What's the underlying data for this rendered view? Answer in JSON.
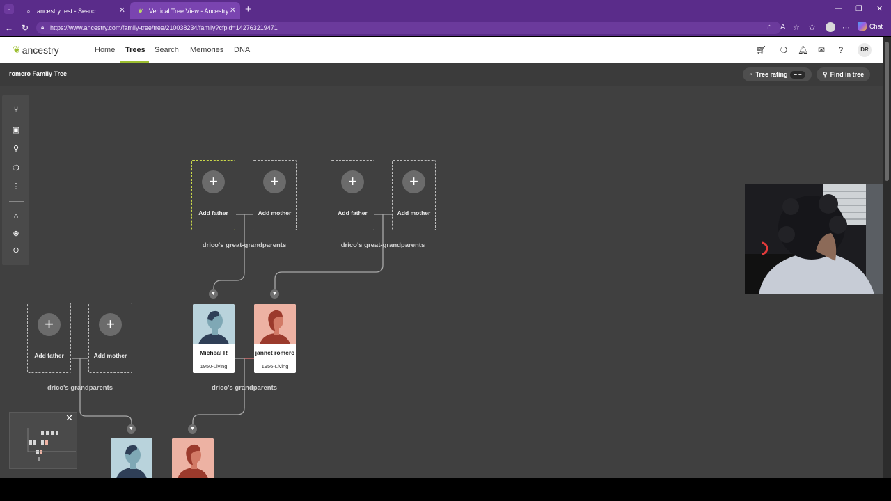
{
  "browser": {
    "tabs": [
      {
        "title": "ancestry test - Search",
        "active": false
      },
      {
        "title": "Vertical Tree View - Ancestry",
        "active": true
      }
    ],
    "url": "https://www.ancestry.com/family-tree/tree/210038234/family?cfpid=142763219471",
    "chat_label": "Chat"
  },
  "site": {
    "logo_text": "ancestry",
    "nav": [
      "Home",
      "Trees",
      "Search",
      "Memories",
      "DNA"
    ],
    "active_nav": "Trees",
    "user_initials": "DR"
  },
  "tree": {
    "title": "romero Family Tree",
    "tree_rating_label": "Tree rating",
    "tree_rating_value": "– –",
    "find_label": "Find in tree"
  },
  "labels": {
    "add_father": "Add father",
    "add_mother": "Add mother",
    "great_grandparents": "drico's great-grandparents",
    "grandparents": "drico's grandparents"
  },
  "people": [
    {
      "name": "Micheal R",
      "years": "1950-Living",
      "gender": "male"
    },
    {
      "name": "jannet romero",
      "years": "1956-Living",
      "gender": "female"
    }
  ],
  "colors": {
    "browser_purple": "#5a2c8a",
    "brand_green": "#9cbe30",
    "canvas": "#404040",
    "male_bg": "#b9d3dc",
    "female_bg": "#edb2a3"
  }
}
